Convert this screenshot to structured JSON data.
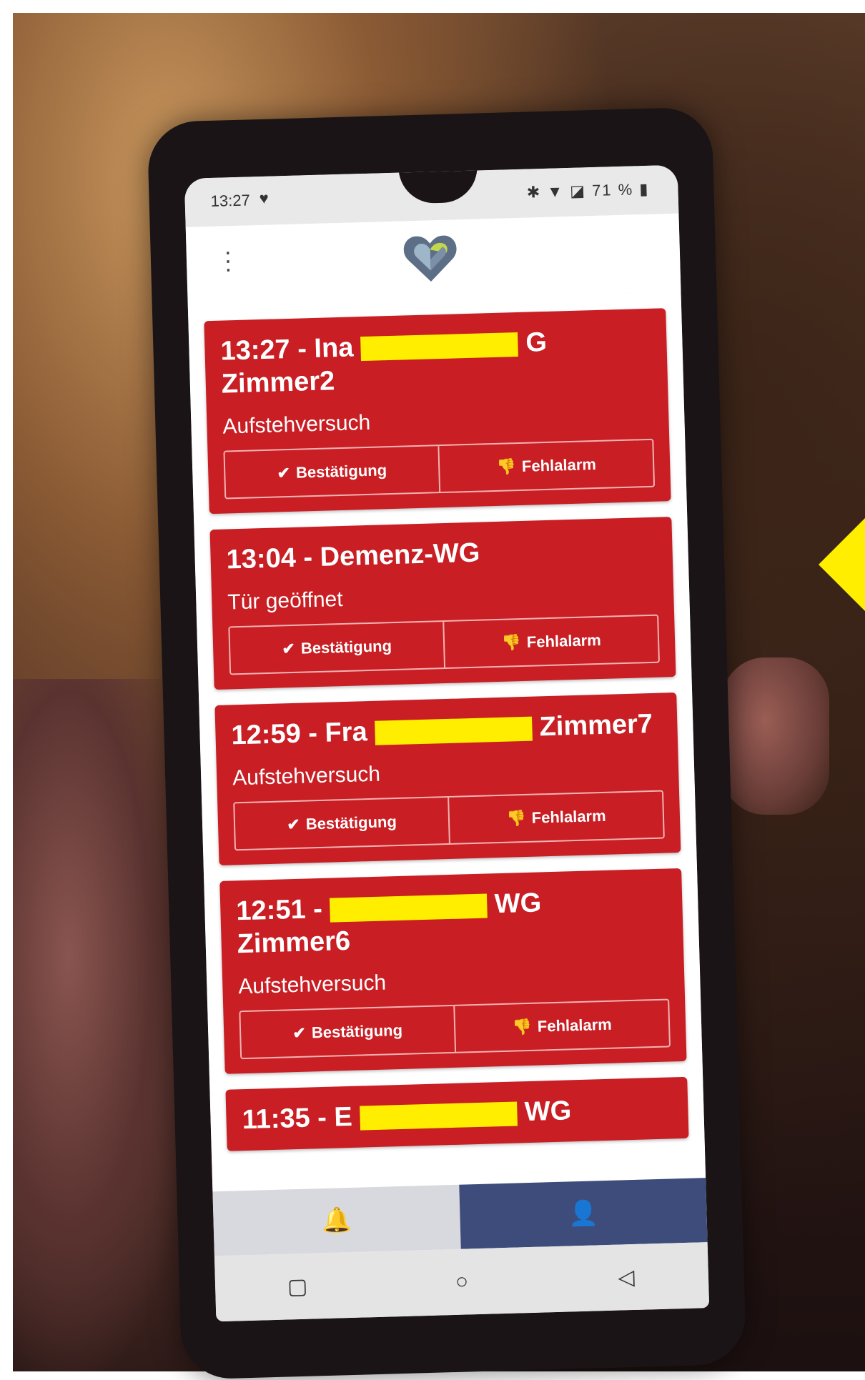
{
  "status_bar": {
    "time": "13:27",
    "right_indicators": "✱ ▼ ◪ 71 % ▮"
  },
  "app_bar": {
    "menu_icon": "more-vert-icon",
    "logo": "heart-logo"
  },
  "alarms": [
    {
      "title_prefix": "13:27 - Ina",
      "title_suffix": "G",
      "title_line2": "Zimmer2",
      "type": "Aufstehversuch",
      "confirm_label": "Bestätigung",
      "false_alarm_label": "Fehlalarm"
    },
    {
      "title_prefix": "13:04 - Demenz-WG",
      "title_suffix": "",
      "title_line2": "",
      "type": "Tür geöffnet",
      "confirm_label": "Bestätigung",
      "false_alarm_label": "Fehlalarm"
    },
    {
      "title_prefix": "12:59 - Fra",
      "title_suffix": "Zimmer7",
      "title_line2": "",
      "type": "Aufstehversuch",
      "confirm_label": "Bestätigung",
      "false_alarm_label": "Fehlalarm"
    },
    {
      "title_prefix": "12:51 -",
      "title_suffix": "WG",
      "title_line2": "Zimmer6",
      "type": "Aufstehversuch",
      "confirm_label": "Bestätigung",
      "false_alarm_label": "Fehlalarm"
    },
    {
      "title_prefix": "11:35 - E",
      "title_suffix": "WG",
      "title_line2": "",
      "type": "",
      "confirm_label": "",
      "false_alarm_label": ""
    }
  ],
  "bottom_nav": {
    "alarms_icon": "bell-icon",
    "profile_icon": "person-icon"
  },
  "system_nav": {
    "recents": "▢",
    "home": "○",
    "back": "◁"
  },
  "colors": {
    "card_red": "#c81e24",
    "nav_active": "#3d4c7a",
    "redaction": "#ffee00"
  }
}
